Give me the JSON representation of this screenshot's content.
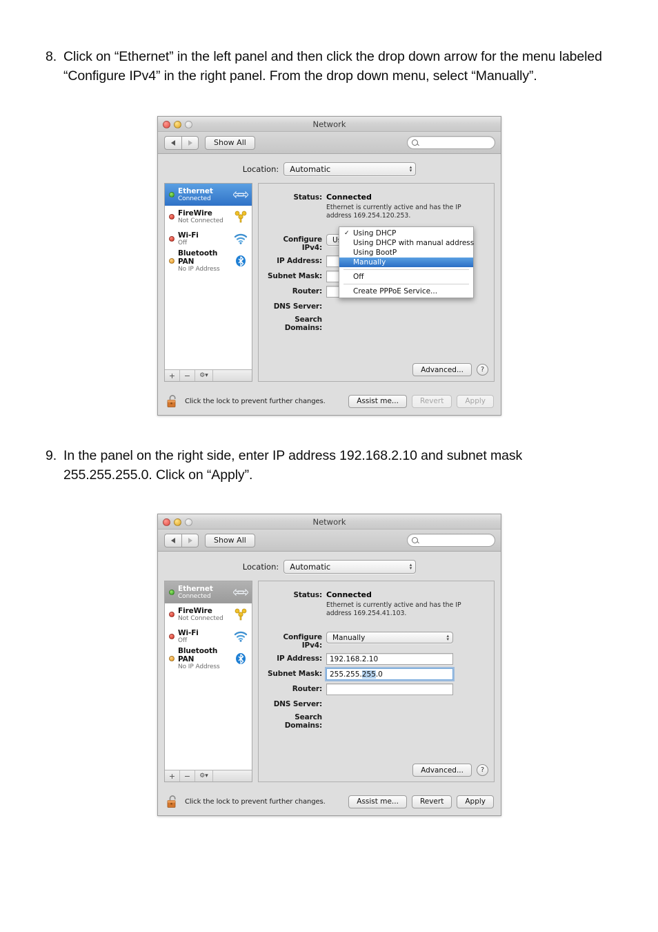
{
  "steps": [
    {
      "number": "8.",
      "text": "Click on “Ethernet” in the left panel and then click the drop down arrow for the menu labeled “Configure IPv4” in the right panel. From the drop down menu, select “Manually”."
    },
    {
      "number": "9.",
      "text": "In the panel on the right side, enter IP address 192.168.2.10 and subnet mask 255.255.255.0. Click on “Apply”."
    }
  ],
  "window1": {
    "title": "Network",
    "toolbar": {
      "back_icon": "triangle-left-icon",
      "forward_icon": "triangle-right-icon",
      "show_all_label": "Show All",
      "search_placeholder": ""
    },
    "location": {
      "label": "Location:",
      "value": "Automatic"
    },
    "services": [
      {
        "name": "Ethernet",
        "sub": "Connected",
        "dot": "green",
        "icon": "ethernet-icon",
        "state": "selected-focused"
      },
      {
        "name": "FireWire",
        "sub": "Not Connected",
        "dot": "red",
        "icon": "firewire-icon",
        "state": "normal"
      },
      {
        "name": "Wi-Fi",
        "sub": "Off",
        "dot": "red",
        "icon": "wifi-icon",
        "state": "normal"
      },
      {
        "name": "Bluetooth PAN",
        "sub": "No IP Address",
        "dot": "orange",
        "icon": "bluetooth-icon",
        "state": "normal"
      }
    ],
    "sidebar_footer": {
      "add": "+",
      "remove": "−",
      "gear": "⚙▾"
    },
    "detail": {
      "status_label": "Status:",
      "status_value": "Connected",
      "status_desc": "Ethernet is currently active and has the IP address 169.254.120.253.",
      "configure_label": "Configure IPv4:",
      "configure_value": "Using DHCP",
      "ip_label": "IP Address:",
      "ip_value": "",
      "subnet_label": "Subnet Mask:",
      "subnet_value": "",
      "router_label": "Router:",
      "router_value": "",
      "dns_label": "DNS Server:",
      "search_domains_label": "Search Domains:",
      "advanced_label": "Advanced...",
      "help_label": "?"
    },
    "menu": {
      "items": [
        {
          "label": "Using DHCP",
          "checked": true,
          "highlight": false,
          "separator_after": false
        },
        {
          "label": "Using DHCP with manual address",
          "checked": false,
          "highlight": false,
          "separator_after": false
        },
        {
          "label": "Using BootP",
          "checked": false,
          "highlight": false,
          "separator_after": false
        },
        {
          "label": "Manually",
          "checked": false,
          "highlight": true,
          "separator_after": true
        },
        {
          "label": "Off",
          "checked": false,
          "highlight": false,
          "separator_after": true
        },
        {
          "label": "Create PPPoE Service...",
          "checked": false,
          "highlight": false,
          "separator_after": false
        }
      ]
    },
    "footer": {
      "lock_icon": "unlocked-padlock-icon",
      "lock_text": "Click the lock to prevent further changes.",
      "assist_label": "Assist me...",
      "revert_label": "Revert",
      "apply_label": "Apply",
      "revert_enabled": false,
      "apply_enabled": false
    }
  },
  "window2": {
    "title": "Network",
    "toolbar": {
      "back_icon": "triangle-left-icon",
      "forward_icon": "triangle-right-icon",
      "show_all_label": "Show All",
      "search_placeholder": ""
    },
    "location": {
      "label": "Location:",
      "value": "Automatic"
    },
    "services": [
      {
        "name": "Ethernet",
        "sub": "Connected",
        "dot": "green",
        "icon": "ethernet-icon",
        "state": "selected-unfocused"
      },
      {
        "name": "FireWire",
        "sub": "Not Connected",
        "dot": "red",
        "icon": "firewire-icon",
        "state": "normal"
      },
      {
        "name": "Wi-Fi",
        "sub": "Off",
        "dot": "red",
        "icon": "wifi-icon",
        "state": "normal"
      },
      {
        "name": "Bluetooth PAN",
        "sub": "No IP Address",
        "dot": "orange",
        "icon": "bluetooth-icon",
        "state": "normal"
      }
    ],
    "sidebar_footer": {
      "add": "+",
      "remove": "−",
      "gear": "⚙▾"
    },
    "detail": {
      "status_label": "Status:",
      "status_value": "Connected",
      "status_desc": "Ethernet is currently active and has the IP address 169.254.41.103.",
      "configure_label": "Configure IPv4:",
      "configure_value": "Manually",
      "ip_label": "IP Address:",
      "ip_value": "192.168.2.10",
      "subnet_label": "Subnet Mask:",
      "subnet_value_pre": "255.255.",
      "subnet_value_sel": "255",
      "subnet_value_post": ".0",
      "router_label": "Router:",
      "router_value": "",
      "dns_label": "DNS Server:",
      "search_domains_label": "Search Domains:",
      "advanced_label": "Advanced...",
      "help_label": "?"
    },
    "footer": {
      "lock_icon": "unlocked-padlock-icon",
      "lock_text": "Click the lock to prevent further changes.",
      "assist_label": "Assist me...",
      "revert_label": "Revert",
      "apply_label": "Apply",
      "revert_enabled": true,
      "apply_enabled": true
    }
  },
  "colors": {
    "selection_blue": "#2f72c7",
    "selection_gray": "#9a9a9a",
    "text_selection": "#b5d3ef",
    "window_bg": "#dedede"
  }
}
